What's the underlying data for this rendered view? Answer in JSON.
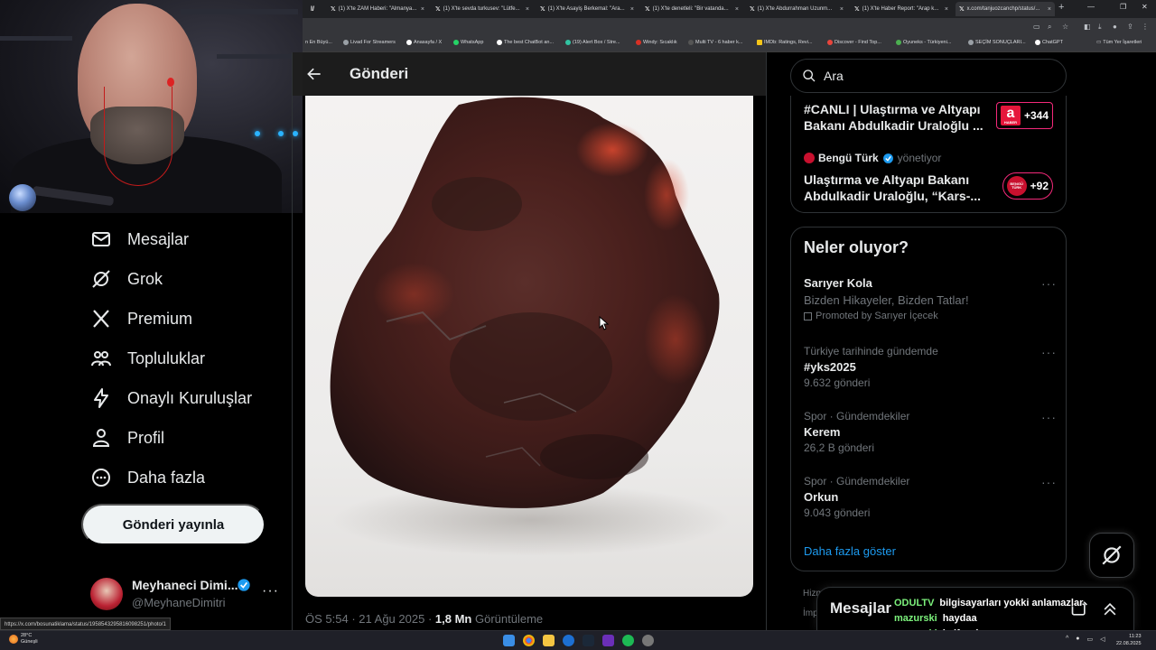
{
  "browser": {
    "tabs": [
      {
        "label": "(1) X'te ZAM Haberi: \"Almanya..."
      },
      {
        "label": "(1) X'te sevda turkusev: \"Lütfe..."
      },
      {
        "label": "(1) X'te Asayiş Berkemal: \"Ara..."
      },
      {
        "label": "(1) X'te denetleli: \"Bir vatanda..."
      },
      {
        "label": "(1) X'te Abdurrahman Uzunm..."
      },
      {
        "label": "(1) X'te Haber Report: \"Arap k..."
      },
      {
        "label": "x.com/tanjuozcanchp/status/..."
      }
    ],
    "bookmarks": [
      {
        "label": "n En Büyü...",
        "color": "#9aa0a6"
      },
      {
        "label": "Livad For Streamers",
        "color": "#9aa0a6"
      },
      {
        "label": "Anasayfa / X",
        "color": "#ffffff"
      },
      {
        "label": "WhatsApp",
        "color": "#25d366"
      },
      {
        "label": "The best ChatBot an...",
        "color": "#ffffff"
      },
      {
        "label": "(19) Alert Box / Stre...",
        "color": "#31c3a2"
      },
      {
        "label": "Windy: Sıcaklık",
        "color": "#d93025"
      },
      {
        "label": "Multi TV - 6 haber k...",
        "color": "#333333"
      },
      {
        "label": "IMDb: Ratings, Revi...",
        "color": "#f5c518"
      },
      {
        "label": "Discover - Find Top...",
        "color": "#e8453c"
      },
      {
        "label": "Oyuneks - Türkiyeni...",
        "color": "#4caf50"
      },
      {
        "label": "SEÇİM SONUÇLARI...",
        "color": "#9aa0a6"
      },
      {
        "label": "ChatGPT",
        "color": "#ffffff"
      }
    ],
    "all_bookmarks": "Tüm Yer İşaretleri",
    "status_url": "https://x.com/bosunatiklama/status/1958543295816098251/photo/1"
  },
  "nav": {
    "items": [
      {
        "label": "Mesajlar",
        "icon": "envelope-icon"
      },
      {
        "label": "Grok",
        "icon": "grok-icon"
      },
      {
        "label": "Premium",
        "icon": "x-logo-icon"
      },
      {
        "label": "Topluluklar",
        "icon": "communities-icon"
      },
      {
        "label": "Onaylı Kuruluşlar",
        "icon": "lightning-icon"
      },
      {
        "label": "Profil",
        "icon": "person-icon"
      },
      {
        "label": "Daha fazla",
        "icon": "more-circle-icon"
      }
    ],
    "post_button": "Gönderi yayınla"
  },
  "account": {
    "name": "Meyhaneci Dimi...",
    "handle": "@MeyhaneDimitri",
    "more": "···"
  },
  "post": {
    "header_title": "Gönderi",
    "time": "ÖS 5:54",
    "separator": "·",
    "date": "21 Ağu 2025",
    "views_count": "1,8 Mn",
    "views_label": "Görüntüleme"
  },
  "search": {
    "placeholder": "Ara"
  },
  "news": [
    {
      "title": "#CANLI | Ulaştırma ve Altyapı Bakanı Abdulkadir Uraloğlu ...",
      "badge": "+344",
      "badge_logo": "a",
      "badge_logo_sub": "HABER",
      "badge_color": "#e5163b"
    },
    {
      "source": "Bengü Türk",
      "source_sub": "yönetiyor",
      "title": "Ulaştırma ve Altyapı Bakanı Abdulkadir Uraloğlu, “Kars-...",
      "badge": "+92",
      "badge_logo": "BENGÜ",
      "badge_logo_sub": "TÜRK",
      "badge_color": "#c8102e"
    }
  ],
  "trends": {
    "title": "Neler oluyor?",
    "ad": {
      "name": "Sarıyer Kola",
      "desc": "Bizden Hikayeler, Bizden Tatlar!",
      "promoted": "Promoted by Sarıyer İçecek"
    },
    "items": [
      {
        "context": "Türkiye tarihinde gündemde",
        "name": "#yks2025",
        "count": "9.632 gönderi"
      },
      {
        "context": "Spor · Gündemdekiler",
        "name": "Kerem",
        "count": "26,2 B gönderi"
      },
      {
        "context": "Spor · Gündemdekiler",
        "name": "Orkun",
        "count": "9.043 gönderi"
      }
    ],
    "more_dots": "···",
    "show_more": "Daha fazla göster"
  },
  "footer": {
    "partial1": "Hizm",
    "partial2": "İmpl"
  },
  "messages": {
    "title": "Mesajlar"
  },
  "chat": [
    {
      "user": "ODULTV",
      "msg": "bilgisayarları yokki anlamazlar"
    },
    {
      "user": "mazurski",
      "msg": "haydaa"
    },
    {
      "user": "mazurski",
      "msg": "kalforniyum"
    }
  ],
  "taskbar": {
    "weather_temp": "28°C",
    "weather_desc": "Güneşli",
    "time": "11:23",
    "date": "22.08.2025"
  },
  "colors": {
    "accent": "#1d9bf0",
    "text": "#e7e9ea",
    "muted": "#71767b",
    "border": "#2f3336",
    "chat_user": "#7cf27c"
  }
}
